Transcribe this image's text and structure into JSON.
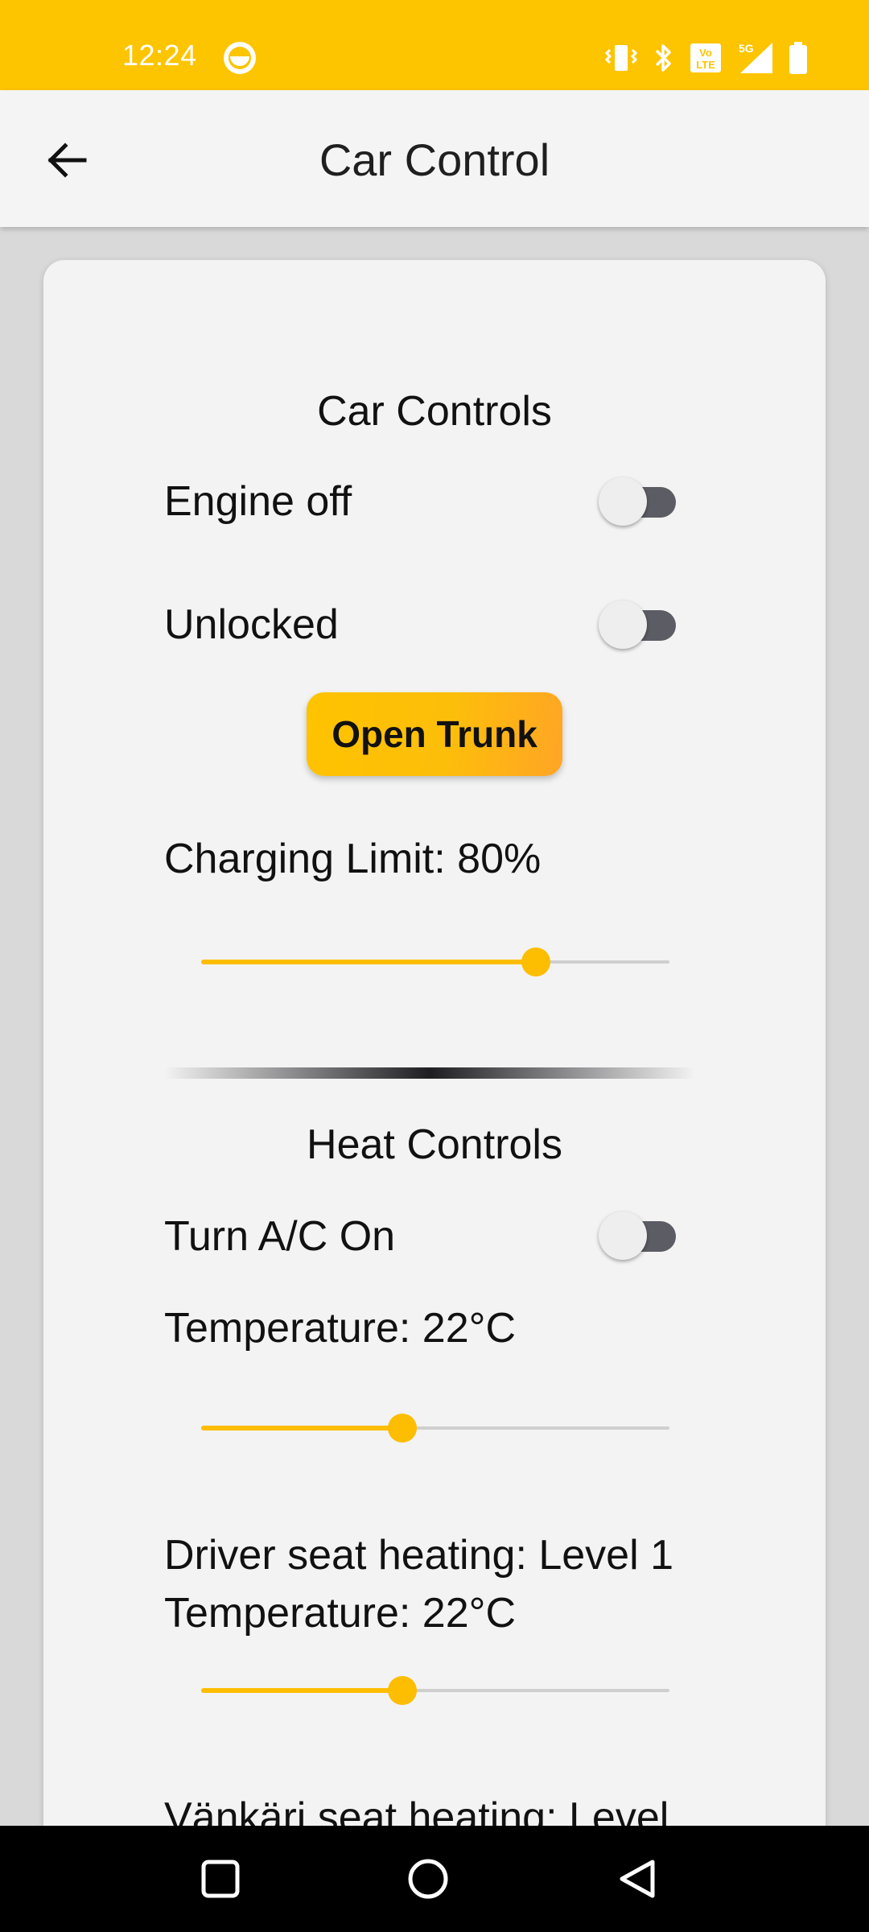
{
  "status_bar": {
    "time": "12:24",
    "icons": [
      "face-icon",
      "vibrate-icon",
      "bluetooth-icon",
      "volte-icon",
      "signal-5g-icon",
      "battery-icon"
    ]
  },
  "app_bar": {
    "title": "Car Control",
    "back_icon": "arrow-left-icon"
  },
  "car_controls": {
    "title": "Car Controls",
    "engine": {
      "label": "Engine off",
      "on": false
    },
    "lock": {
      "label": "Unlocked",
      "on": false
    },
    "trunk_button": "Open Trunk",
    "charging": {
      "label": "Charging Limit: 80%",
      "value_fraction": 0.714
    }
  },
  "heat_controls": {
    "title": "Heat Controls",
    "ac": {
      "label": "Turn A/C On",
      "on": false
    },
    "temperature": {
      "label": "Temperature: 22°C",
      "value_fraction": 0.43
    },
    "driver_seat": {
      "label": "Driver seat heating: Level 1",
      "sub_label": "Temperature: 22°C",
      "value_fraction": 0.43
    },
    "passenger_seat": {
      "label": "Vänkäri seat heating: Level"
    }
  },
  "colors": {
    "accent": "#fdbd00",
    "status_bar": "#fdc400",
    "switch_track": "#5c5c64"
  },
  "nav_bar": {
    "icons": [
      "recents-square-icon",
      "home-circle-icon",
      "back-triangle-icon"
    ]
  }
}
